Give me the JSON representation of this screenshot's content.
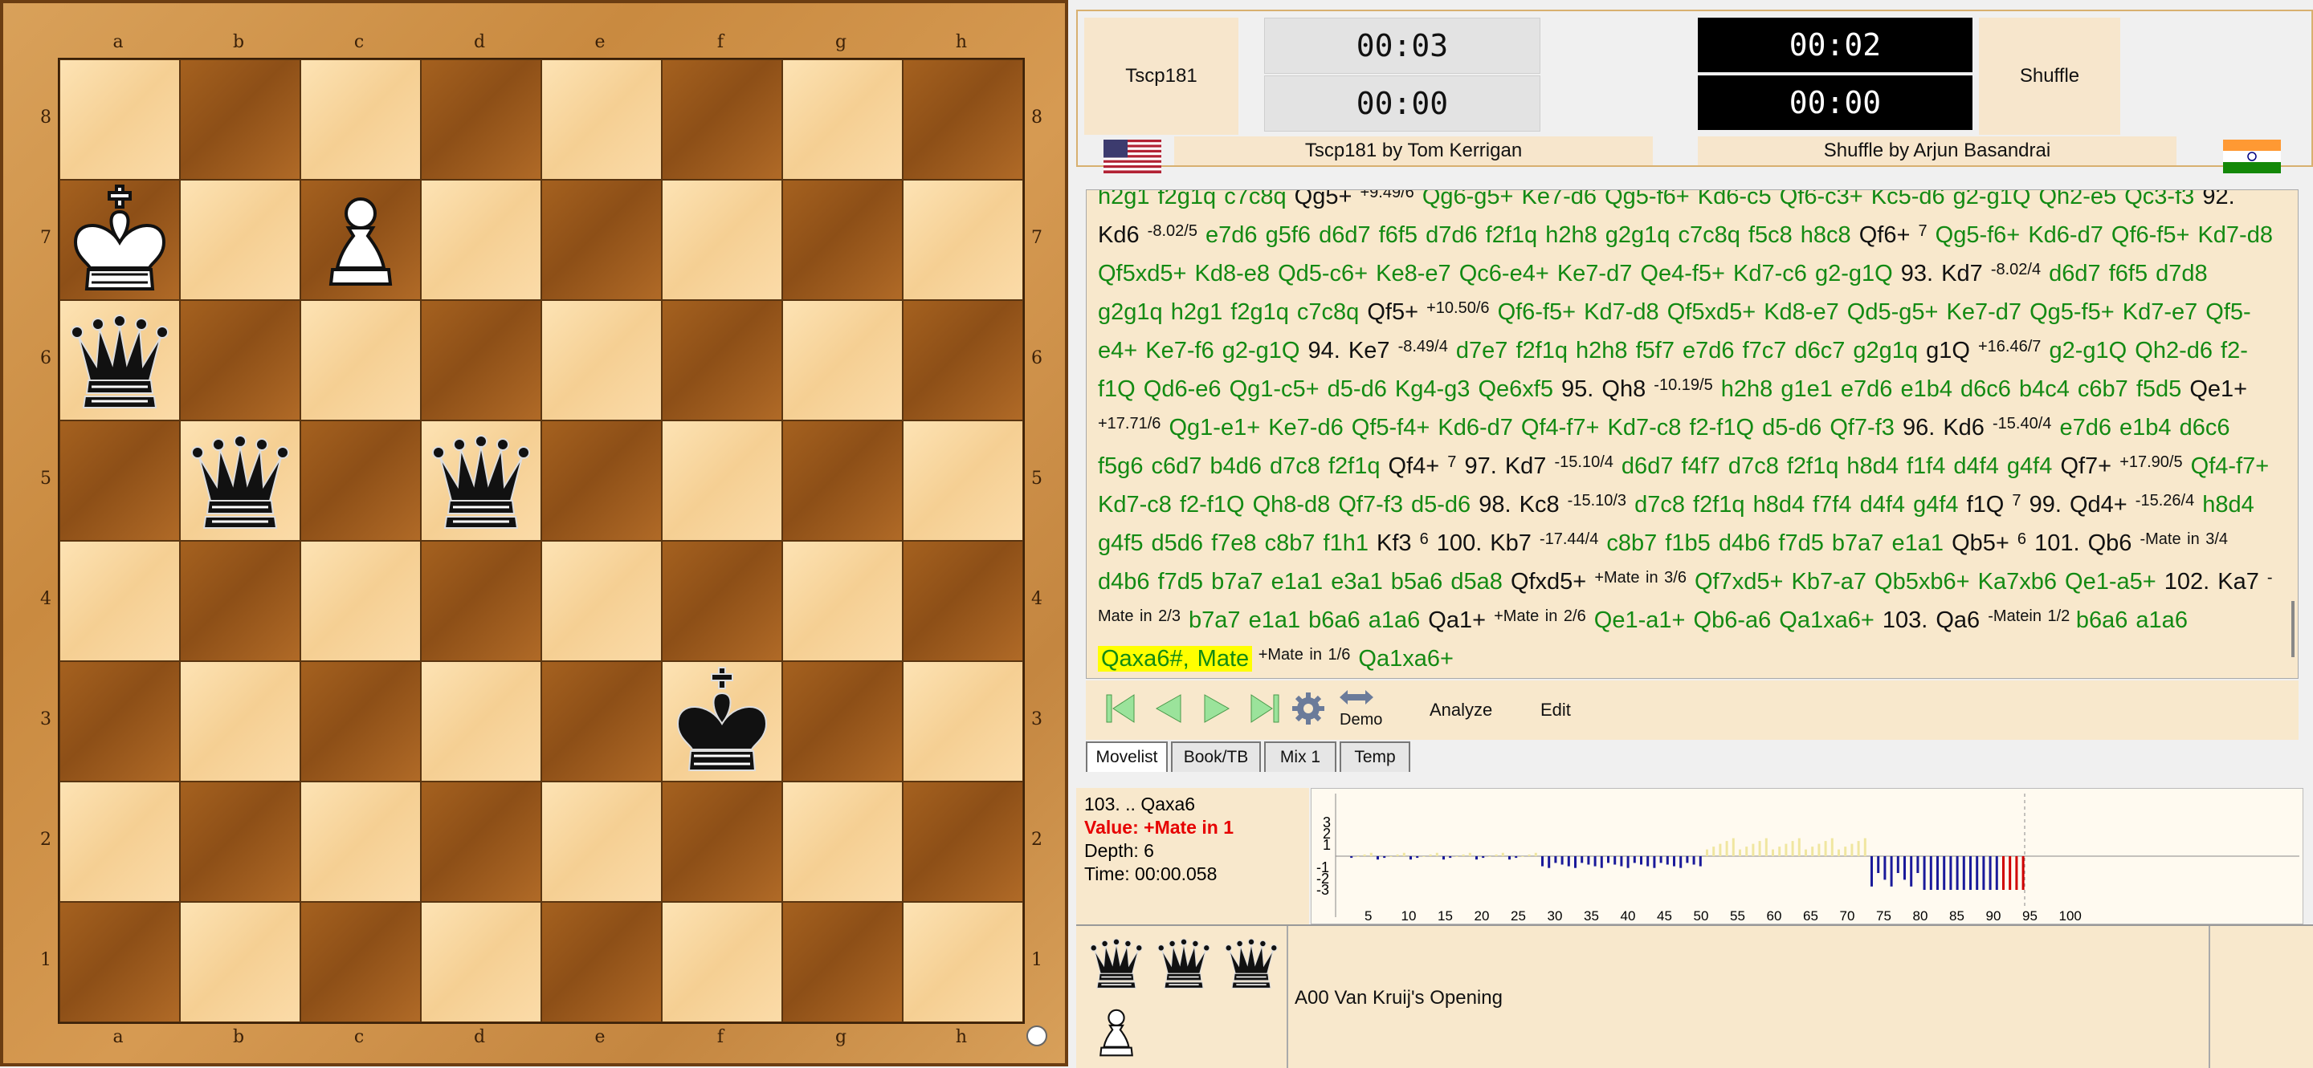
{
  "board": {
    "files": [
      "a",
      "b",
      "c",
      "d",
      "e",
      "f",
      "g",
      "h"
    ],
    "ranks": [
      "8",
      "7",
      "6",
      "5",
      "4",
      "3",
      "2",
      "1"
    ],
    "pieces": [
      {
        "square": "a7",
        "piece": "white-king"
      },
      {
        "square": "c7",
        "piece": "white-pawn"
      },
      {
        "square": "a6",
        "piece": "black-queen"
      },
      {
        "square": "b5",
        "piece": "black-queen"
      },
      {
        "square": "d5",
        "piece": "black-queen"
      },
      {
        "square": "f3",
        "piece": "black-king"
      }
    ],
    "colors": {
      "light": "#f8d8a0",
      "dark": "#9c5a1c",
      "frame": "#cf9347"
    }
  },
  "players": {
    "white": {
      "name": "Tscp181",
      "byline": "Tscp181 by Tom Kerrigan",
      "clock_main": "00:03",
      "clock_sub": "00:00",
      "flag": "us-flag"
    },
    "black": {
      "name": "Shuffle",
      "byline": "Shuffle by Arjun Basandrai",
      "clock_main": "00:02",
      "clock_sub": "00:00",
      "flag": "india-flag"
    }
  },
  "movelist_html_tokens": [
    [
      "g",
      "h2g1 f2g1q c7c8q "
    ],
    [
      "k",
      "Qg5+ "
    ],
    [
      "s",
      "+9.49/6"
    ],
    [
      "g",
      " Qg6-g5+ Ke7-d6 Qg5-f6+ Kd6-c5 Qf6-c3+ Kc5-d6 g2-g1Q Qh2-e5 "
    ],
    [
      "g",
      "Qc3-f3 "
    ],
    [
      "k",
      "92. Kd6 "
    ],
    [
      "s",
      "-8.02/5"
    ],
    [
      "g",
      " e7d6 g5f6 d6d7 f6f5 d7d6 f2f1q h2h8 g2g1q c7c8q f5c8 h8c8 "
    ],
    [
      "k",
      "Qf6+ "
    ],
    [
      "s",
      "7"
    ],
    [
      "g",
      "  Qg5-f6+ "
    ],
    [
      "g",
      "Kd6-d7 Qf6-f5+ Kd7-d8 Qf5xd5+ Kd8-e8 Qd5-c6+ Ke8-e7 Qc6-e4+ Ke7-d7 Qe4-f5+ Kd7-c6 g2-g1Q "
    ],
    [
      "k",
      "93. Kd7 "
    ],
    [
      "s",
      "-8.02/4"
    ],
    [
      "g",
      " d6d7 f6f5 d7d8 g2g1q h2g1 f2g1q c7c8q "
    ],
    [
      "k",
      "Qf5+ "
    ],
    [
      "s",
      "+10.50/6"
    ],
    [
      "g",
      "  Qf6-f5+ Kd7-d8 Qf5xd5+ Kd8-e7 "
    ],
    [
      "g",
      "Qd5-g5+ Ke7-d7 Qg5-f5+ Kd7-e7 Qf5-e4+ Ke7-f6 g2-g1Q "
    ],
    [
      "k",
      "94. Ke7 "
    ],
    [
      "s",
      "-8.49/4"
    ],
    [
      "g",
      "  d7e7 f2f1q h2h8 f5f7 e7d6 "
    ],
    [
      "g",
      "f7c7 d6c7 g2g1q "
    ],
    [
      "k",
      "g1Q "
    ],
    [
      "s",
      "+16.46/7"
    ],
    [
      "g",
      " g2-g1Q Qh2-d6 f2-f1Q Qd6-e6 Qg1-c5+ d5-d6 Kg4-g3 Qe6xf5 "
    ],
    [
      "k",
      "95. Qh8 "
    ],
    [
      "s",
      "-10.19/5"
    ],
    [
      "g",
      " h2h8 g1e1 e7d6 e1b4 d6c6 b4c4 c6b7 f5d5 "
    ],
    [
      "k",
      "Qe1+ "
    ],
    [
      "s",
      "+17.71/6"
    ],
    [
      "g",
      "  Qg1-e1+ Ke7-d6 Qf5-f4+ Kd6-d7 "
    ],
    [
      "g",
      "Qf4-f7+ Kd7-c8 f2-f1Q d5-d6 Qf7-f3 "
    ],
    [
      "k",
      "96. Kd6 "
    ],
    [
      "s",
      "-15.40/4"
    ],
    [
      "g",
      " e7d6 e1b4 d6c6 f5g6 c6d7 b4d6 d7c8 f2f1q "
    ],
    [
      "k",
      "Qf4+ "
    ],
    [
      "s",
      "7"
    ],
    [
      "k",
      " 97. Kd7 "
    ],
    [
      "s",
      "-15.10/4"
    ],
    [
      "g",
      " d6d7 f4f7 d7c8 f2f1q h8d4 f1f4 d4f4 g4f4 "
    ],
    [
      "k",
      "Qf7+ "
    ],
    [
      "s",
      "+17.90/5"
    ],
    [
      "g",
      "  Qf4-f7+ Kd7-c8 f2-f1Q Qh8-d8 "
    ],
    [
      "g",
      "Qf7-f3 d5-d6 "
    ],
    [
      "k",
      "98. Kc8 "
    ],
    [
      "s",
      "-15.10/3"
    ],
    [
      "g",
      " d7c8 f2f1q h8d4 f7f4 d4f4 g4f4 "
    ],
    [
      "k",
      "f1Q "
    ],
    [
      "s",
      "7"
    ],
    [
      "k",
      " 99. Qd4+ "
    ],
    [
      "s",
      "-15.26/4"
    ],
    [
      "g",
      "  h8d4 g4f5 d5d6 "
    ],
    [
      "g",
      "f7e8 c8b7 f1h1 "
    ],
    [
      "k",
      "Kf3 "
    ],
    [
      "s",
      "6"
    ],
    [
      "k",
      " 100. Kb7 "
    ],
    [
      "s",
      "-17.44/4"
    ],
    [
      "g",
      " c8b7 f1b5 d4b6 f7d5 b7a7 e1a1 "
    ],
    [
      "k",
      "Qb5+ "
    ],
    [
      "s",
      "6"
    ],
    [
      "k",
      " 101. Qb6 "
    ],
    [
      "s",
      "-Mate in 3/4"
    ],
    [
      "g",
      " d4b6 f7d5 b7a7 e1a1 e3a1 b5a6 d5a8 "
    ],
    [
      "k",
      "Qfxd5+ "
    ],
    [
      "s",
      "+Mate in 3/6"
    ],
    [
      "g",
      " Qf7xd5+ Kb7-a7 Qb5xb6+ Ka7xb6 Qe1-a5+ "
    ],
    [
      "k",
      "102. Ka7 "
    ],
    [
      "s",
      "-Mate in 2/3"
    ],
    [
      "g",
      " b7a7 e1a1 b6a6 a1a6 "
    ],
    [
      "k",
      "Qa1+ "
    ],
    [
      "s",
      "+Mate in 2/6"
    ],
    [
      "g",
      " Qe1-a1+ Qb6-a6 Qa1xa6+ "
    ],
    [
      "k",
      "103. Qa6 "
    ],
    [
      "s",
      " -Mate"
    ],
    [
      "s",
      "in 1/2 "
    ],
    [
      "g",
      "b6a6 a1a6 "
    ],
    [
      "h",
      "Qaxa6#, Mate"
    ],
    [
      "s",
      " +Mate in 1/6"
    ],
    [
      "g",
      " Qa1xa6+"
    ]
  ],
  "toolbar": {
    "demo_label": "Demo",
    "analyze_label": "Analyze",
    "edit_label": "Edit"
  },
  "tabs": [
    "Movelist",
    "Book/TB",
    "Mix 1",
    "Temp"
  ],
  "info": {
    "move": "103. .. Qaxa6",
    "value": "Value: +Mate in 1",
    "depth": "Depth: 6",
    "time": "Time: 00:00.058"
  },
  "graph": {
    "y_ticks": [
      "3",
      "2",
      "1",
      "-1",
      "-2",
      "-3"
    ],
    "x_ticks": [
      "5",
      "10",
      "15",
      "20",
      "25",
      "30",
      "35",
      "40",
      "45",
      "50",
      "55",
      "60",
      "65",
      "70",
      "75",
      "80",
      "85",
      "90",
      "95",
      "100"
    ]
  },
  "captured": {
    "white_side": [
      "black-queen",
      "black-queen",
      "black-queen"
    ],
    "black_side": [
      "white-pawn"
    ]
  },
  "opening": "A00  Van Kruij's Opening"
}
